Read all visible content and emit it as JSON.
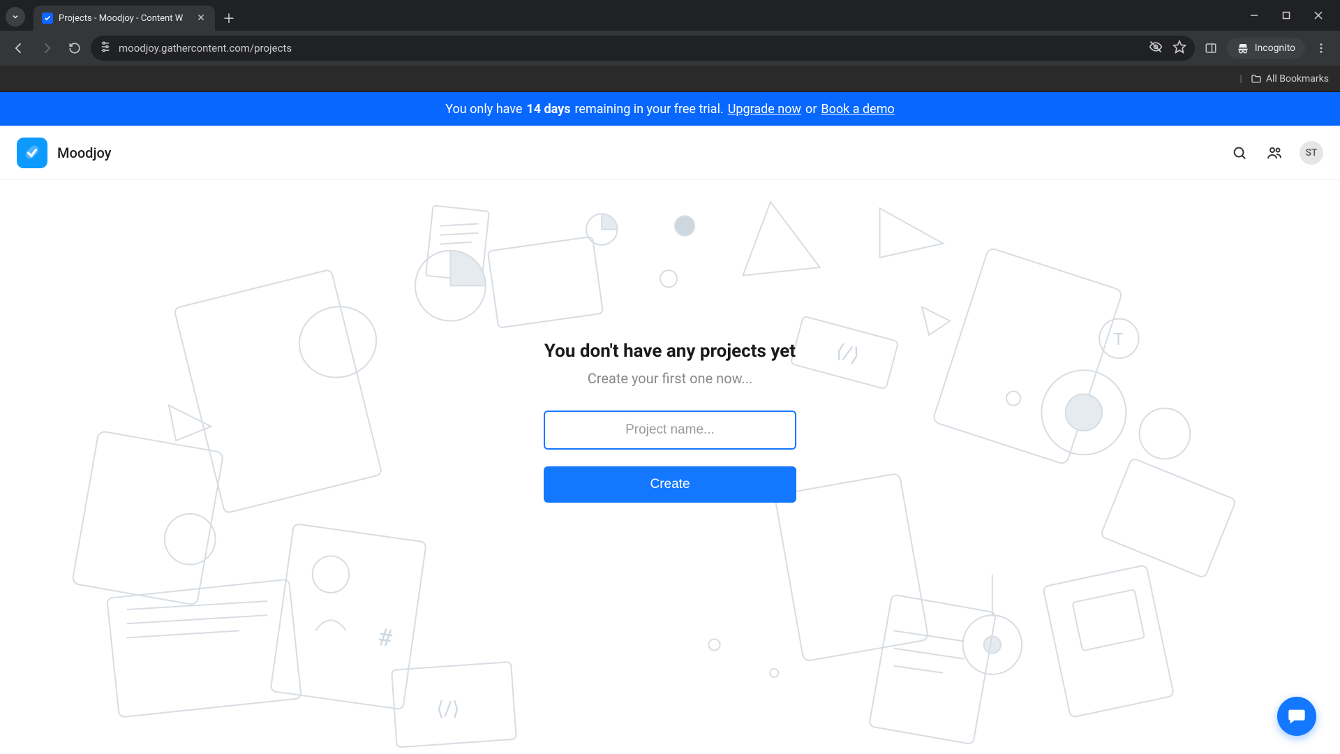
{
  "browser": {
    "tab_title": "Projects - Moodjoy - Content W",
    "url": "moodjoy.gathercontent.com/projects",
    "incognito_label": "Incognito",
    "all_bookmarks_label": "All Bookmarks"
  },
  "banner": {
    "prefix": "You only have ",
    "days_strong": "14 days",
    "middle": " remaining in your free trial. ",
    "upgrade_link": "Upgrade now",
    "or": " or ",
    "demo_link": "Book a demo"
  },
  "header": {
    "workspace_name": "Moodjoy",
    "avatar_initials": "ST"
  },
  "empty_state": {
    "title": "You don't have any projects yet",
    "subtitle": "Create your first one now...",
    "input_placeholder": "Project name...",
    "create_label": "Create"
  }
}
